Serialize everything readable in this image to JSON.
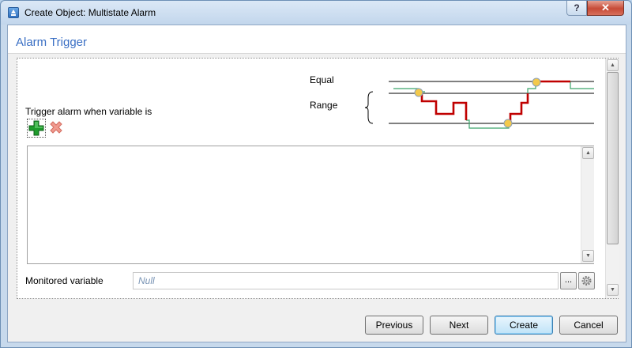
{
  "window": {
    "title": "Create Object: Multistate Alarm",
    "help_label": "?",
    "close_label": "✕",
    "icon": "app-upload-icon"
  },
  "header": {
    "title": "Alarm Trigger"
  },
  "diagram": {
    "equal_label": "Equal",
    "range_label": "Range",
    "colors": {
      "alarm": "#c00000",
      "normal": "#3aa36a",
      "marker": "#f3c94b"
    }
  },
  "trigger": {
    "label": "Trigger alarm when variable is",
    "add_icon": "plus-icon",
    "remove_icon": "x-icon"
  },
  "monitored": {
    "label": "Monitored variable",
    "value": "Null",
    "browse_label": "...",
    "settings_icon": "gear-icon"
  },
  "footer": {
    "previous": "Previous",
    "next": "Next",
    "create": "Create",
    "cancel": "Cancel"
  }
}
